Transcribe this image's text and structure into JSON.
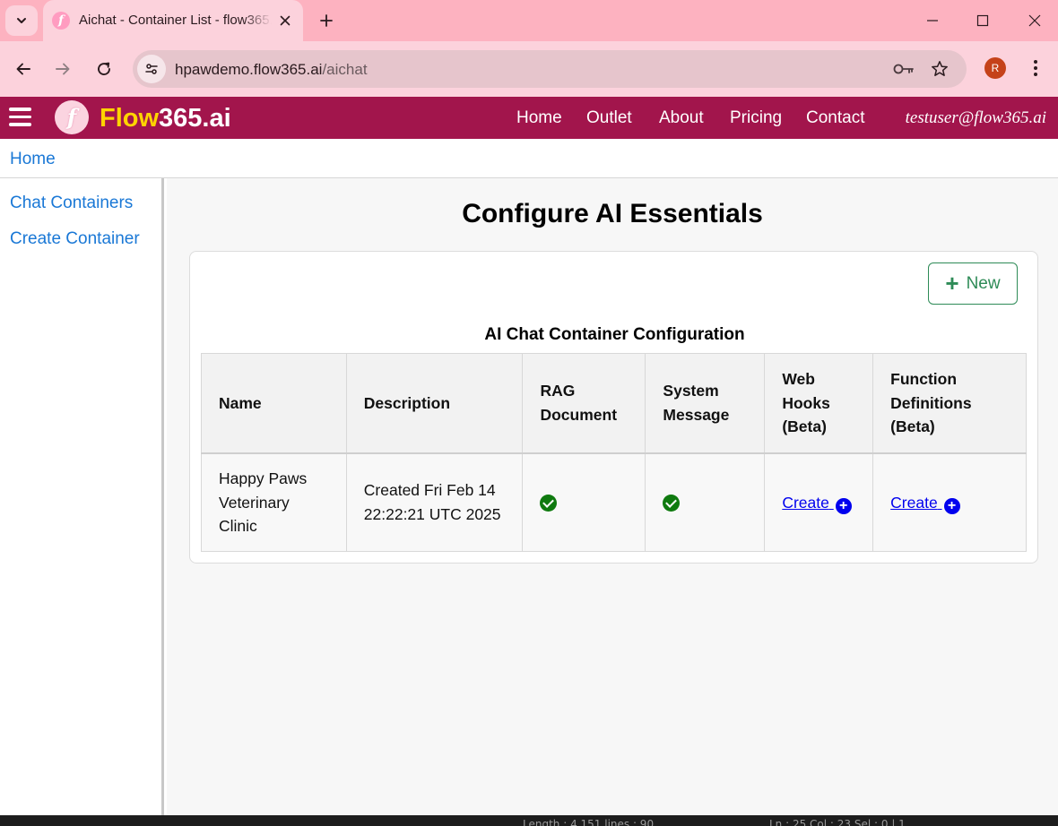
{
  "browser": {
    "tab_title": "Aichat - Container List - flow365.ai",
    "url_host": "hpawdemo.flow365.ai",
    "url_path": "/aichat",
    "profile_initial": "R",
    "icons": [
      "tab-search-icon",
      "close-icon",
      "plus-icon",
      "minimize-icon",
      "maximize-icon",
      "window-close-icon",
      "back-arrow-icon",
      "forward-arrow-icon",
      "reload-icon",
      "site-info-icon",
      "key-icon",
      "star-icon",
      "kebab-menu-icon"
    ]
  },
  "header": {
    "brand_part1": "Flow",
    "brand_part2": "365.ai",
    "logo_glyph": "f",
    "nav": [
      "Home",
      "Outlet",
      "About",
      "Pricing",
      "Contact"
    ],
    "user": "testuser@flow365.ai",
    "colors": {
      "background": "#a2154c",
      "brand_yellow": "#ffd400"
    }
  },
  "breadcrumb": {
    "home": "Home"
  },
  "sidebar": {
    "items": [
      "Chat Containers",
      "Create Container"
    ]
  },
  "main": {
    "title": "Configure AI Essentials",
    "new_button": "New",
    "table_caption": "AI Chat Container Configuration",
    "headers": {
      "name": "Name",
      "description": "Description",
      "rag": [
        "RAG",
        "Document"
      ],
      "system": [
        "System",
        "Message"
      ],
      "webhooks": [
        "Web",
        "Hooks",
        "(Beta)"
      ],
      "functions": [
        "Function",
        "Definitions",
        "(Beta)"
      ]
    },
    "row": {
      "name_lines": [
        "Happy Paws",
        "Veterinary",
        "Clinic"
      ],
      "description_lines": [
        "Created Fri Feb 14",
        "22:22:21 UTC 2025"
      ],
      "rag_document": "check-icon",
      "system_message": "check-icon",
      "webhooks_link": "Create",
      "functions_link": "Create"
    }
  },
  "statusbar": {
    "left": "Length : 4,151    lines : 90",
    "right": "Ln : 25    Col : 23    Sel : 0 | 1"
  }
}
